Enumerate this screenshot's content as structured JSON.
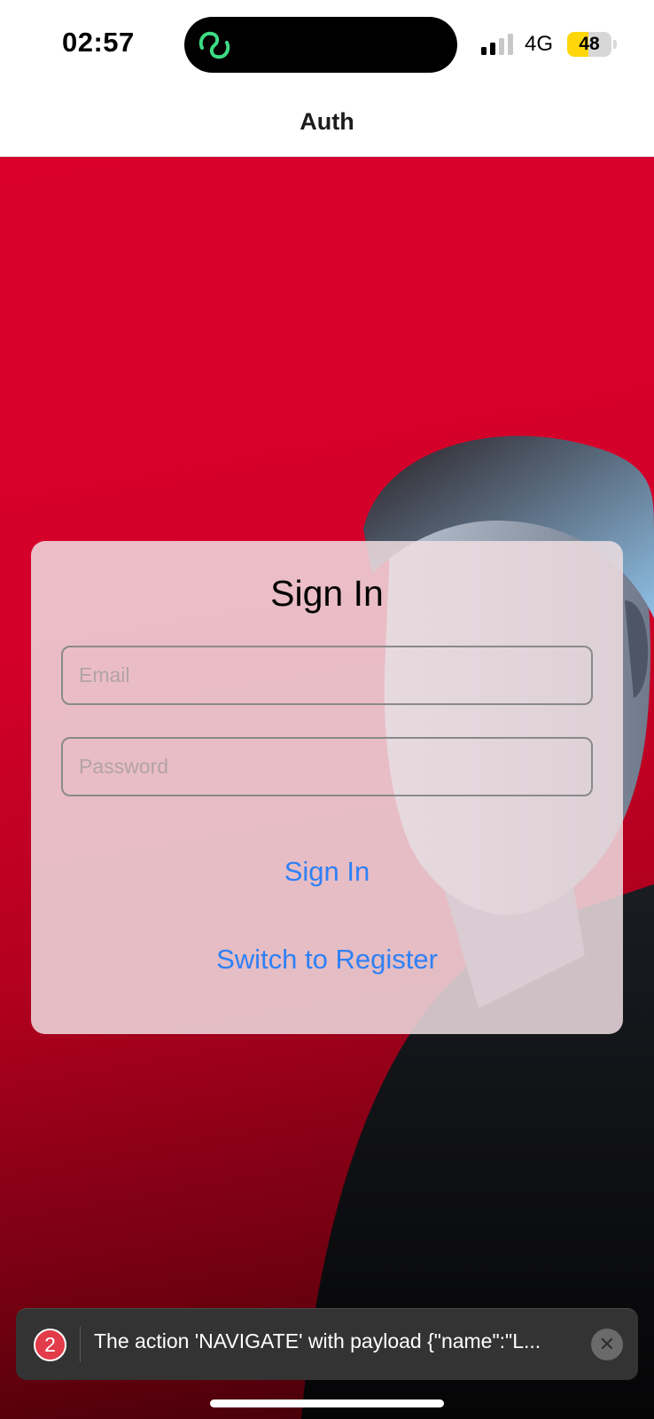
{
  "status_bar": {
    "time": "02:57",
    "network": "4G",
    "battery_level": "48",
    "battery_fraction": 0.48,
    "signal_bars_active": 2,
    "signal_bars_total": 4,
    "island_icon": "chat-link-icon",
    "island_icon_color": "#3ddc84",
    "battery_color": "#ffd60a"
  },
  "header": {
    "title": "Auth"
  },
  "sign_in_card": {
    "title": "Sign In",
    "email_placeholder": "Email",
    "email_value": "",
    "password_placeholder": "Password",
    "password_value": "",
    "sign_in_label": "Sign In",
    "switch_label": "Switch to Register",
    "link_color": "#2f80f5"
  },
  "error_toast": {
    "count": "2",
    "message": "The action 'NAVIGATE' with payload {\"name\":\"L...",
    "close_icon": "close-icon"
  }
}
